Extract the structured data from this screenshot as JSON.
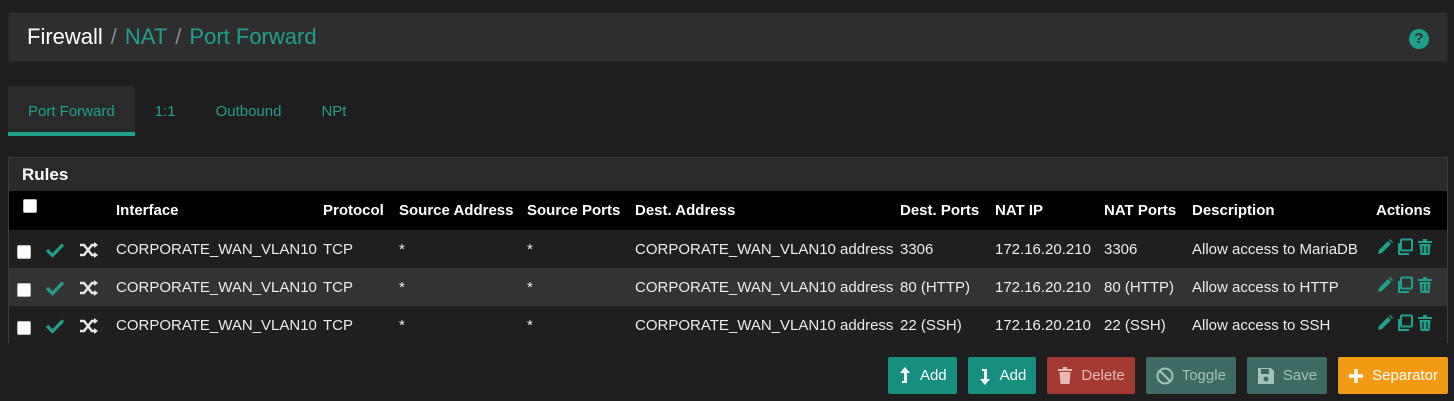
{
  "breadcrumb": {
    "items": [
      "Firewall",
      "NAT",
      "Port Forward"
    ],
    "separator": "/"
  },
  "help_icon": "question-circle-icon",
  "tabs": [
    {
      "label": "Port Forward",
      "active": true
    },
    {
      "label": "1:1",
      "active": false
    },
    {
      "label": "Outbound",
      "active": false
    },
    {
      "label": "NPt",
      "active": false
    }
  ],
  "rules": {
    "title": "Rules",
    "columns": [
      "Interface",
      "Protocol",
      "Source Address",
      "Source Ports",
      "Dest. Address",
      "Dest. Ports",
      "NAT IP",
      "NAT Ports",
      "Description",
      "Actions"
    ],
    "rows": [
      {
        "interface": "CORPORATE_WAN_VLAN10",
        "protocol": "TCP",
        "source_address": "*",
        "source_ports": "*",
        "dest_address": "CORPORATE_WAN_VLAN10 address",
        "dest_ports": "3306",
        "nat_ip": "172.16.20.210",
        "nat_ports": "3306",
        "description": "Allow access to MariaDB"
      },
      {
        "interface": "CORPORATE_WAN_VLAN10",
        "protocol": "TCP",
        "source_address": "*",
        "source_ports": "*",
        "dest_address": "CORPORATE_WAN_VLAN10 address",
        "dest_ports": "80 (HTTP)",
        "nat_ip": "172.16.20.210",
        "nat_ports": "80 (HTTP)",
        "description": "Allow access to HTTP"
      },
      {
        "interface": "CORPORATE_WAN_VLAN10",
        "protocol": "TCP",
        "source_address": "*",
        "source_ports": "*",
        "dest_address": "CORPORATE_WAN_VLAN10 address",
        "dest_ports": "22 (SSH)",
        "nat_ip": "172.16.20.210",
        "nat_ports": "22 (SSH)",
        "description": "Allow access to SSH"
      }
    ]
  },
  "buttons": {
    "add_top": "Add",
    "add_bottom": "Add",
    "delete": "Delete",
    "toggle": "Toggle",
    "save": "Save",
    "separator": "Separator"
  },
  "colors": {
    "accent": "#1fa08b",
    "delete": "#a33a32",
    "separator": "#f39a14"
  }
}
